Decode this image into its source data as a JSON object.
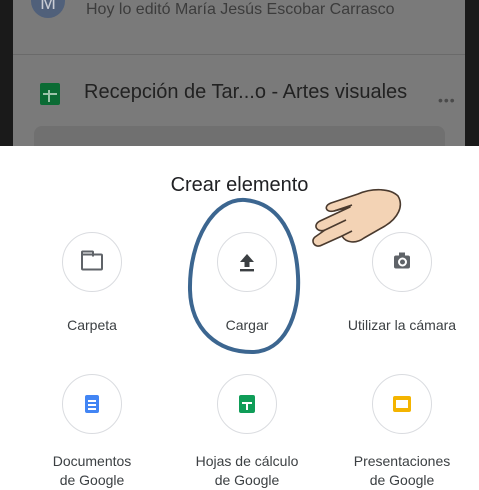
{
  "background": {
    "avatar_letter": "M",
    "activity_text": "Hoy lo editó María Jesús Escobar Carrasco",
    "file_title": "Recepción de Tar...o - Artes visuales",
    "more_icon": "more-horizontal-icon"
  },
  "sheet": {
    "title": "Crear elemento",
    "items": [
      {
        "label": "Carpeta",
        "icon": "folder-icon"
      },
      {
        "label": "Cargar",
        "icon": "upload-icon"
      },
      {
        "label": "Utilizar la cámara",
        "icon": "camera-icon"
      },
      {
        "label": "Documentos\nde Google",
        "icon": "google-docs-icon",
        "color": "#4285f4"
      },
      {
        "label": "Hojas de cálculo\nde Google",
        "icon": "google-sheets-icon",
        "color": "#0f9d58"
      },
      {
        "label": "Presentaciones\nde Google",
        "icon": "google-slides-icon",
        "color": "#f4b400"
      }
    ]
  },
  "annotation": {
    "circle_color": "#3c6690",
    "hand_icon": "pointing-hand-icon"
  }
}
